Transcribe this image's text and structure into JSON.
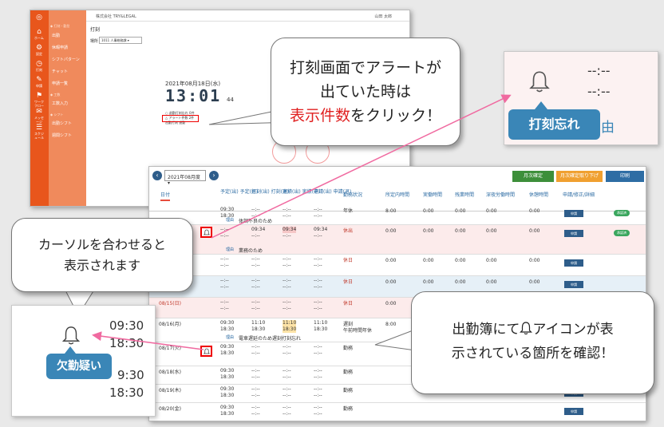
{
  "punch_screen": {
    "company": "株式会社 TRY&LEGAL",
    "user": "山田 太郎",
    "title": "打刻",
    "select_label": "場所",
    "select_value": "1011 人事総務課",
    "date": "2021年08月18日(水)",
    "time": "13:01",
    "seconds": "44",
    "alert_lines": [
      "○ 退勤打刻忘れ 0件",
      "△ アラート件数 2件",
      "出勤打刻  退勤"
    ],
    "nav_items": [
      "ホーム",
      "設定",
      "打刻",
      "申請",
      "ワークフロー",
      "メッセージ",
      "スケジュール"
    ],
    "nav_subs": [
      "出勤",
      "休暇申請",
      "シフトパターン",
      "チャット",
      "申請一覧",
      "工数入力",
      "出勤シフト",
      "週間シフト"
    ],
    "nav_sections": [
      "◆ 打刻・勤怠",
      "◆ 工数",
      "◆ シフト"
    ]
  },
  "attendance": {
    "month": "2021年08月度",
    "buttons": [
      {
        "label": "月次確定",
        "color": "#3d8f3a"
      },
      {
        "label": "月次確定取り下げ",
        "color": "#f0a030"
      },
      {
        "label": "印刷",
        "color": "#2e6da4"
      }
    ],
    "headers": [
      "日付",
      "予定(出)\n予定(退)",
      "打刻(出)\n打刻(退)",
      "実績(出)\n実績(退)",
      "申請(出)\n申請(退)",
      "勤務状況",
      "所定内時間",
      "実働時間",
      "残業時間",
      "深夜労働時間",
      "休憩時間",
      "申請/修正/詳細"
    ],
    "rows": [
      {
        "date": "",
        "plan_in": "09:30",
        "plan_out": "18:30",
        "punch_in": "--:--",
        "punch_out": "--:--",
        "act_in": "--:--",
        "act_out": "--:--",
        "req_in": "--:--",
        "req_out": "--:--",
        "status": "年休",
        "scheduled": "8:00",
        "work": "0:00",
        "overtime": "0:00",
        "night": "0:00",
        "break": "0:00",
        "reason": "体調不良のため",
        "approved": "承認済"
      },
      {
        "date": "",
        "plan_in": "--:--",
        "plan_out": "--:--",
        "punch_in": "09:34",
        "punch_out": "--:--",
        "act_in": "09:34",
        "act_out": "--:--",
        "req_in": "09:34",
        "req_out": "--:--",
        "status": "休出",
        "scheduled": "0:00",
        "work": "0:00",
        "overtime": "0:00",
        "night": "0:00",
        "break": "0:00",
        "reason": "業務のため",
        "approved": "承認済"
      },
      {
        "date": "",
        "plan_in": "--:--",
        "plan_out": "--:--",
        "punch_in": "--:--",
        "punch_out": "--:--",
        "act_in": "--:--",
        "act_out": "--:--",
        "req_in": "--:--",
        "req_out": "--:--",
        "status": "休日",
        "scheduled": "0:00",
        "work": "0:00",
        "overtime": "0:00",
        "night": "0:00",
        "break": "0:00"
      },
      {
        "date": "",
        "plan_in": "--:--",
        "plan_out": "--:--",
        "punch_in": "--:--",
        "punch_out": "--:--",
        "act_in": "--:--",
        "act_out": "--:--",
        "req_in": "--:--",
        "req_out": "--:--",
        "status": "休日",
        "scheduled": "0:00",
        "work": "0:00",
        "overtime": "0:00",
        "night": "0:00",
        "break": "0:00"
      },
      {
        "date": "08/15(日)",
        "plan_in": "--:--",
        "plan_out": "--:--",
        "punch_in": "--:--",
        "punch_out": "--:--",
        "act_in": "--:--",
        "act_out": "--:--",
        "req_in": "--:--",
        "req_out": "--:--",
        "status": "休日",
        "scheduled": "0:00",
        "work": "0:00",
        "overtime": "0:00",
        "night": "0:00",
        "break": "0:00"
      },
      {
        "date": "08/16(月)",
        "plan_in": "09:30",
        "plan_out": "18:30",
        "punch_in": "11:10",
        "punch_out": "18:30",
        "act_in": "11:10",
        "act_out": "18:30",
        "req_in": "11:10",
        "req_out": "18:30",
        "status": "遅刻\n午前時間年休",
        "scheduled": "8:00",
        "reason": "電車遅延のため遅刻打刻忘れ"
      },
      {
        "date": "08/17(火)",
        "plan_in": "09:30",
        "plan_out": "18:30",
        "punch_in": "--:--",
        "punch_out": "--:--",
        "act_in": "--:--",
        "act_out": "--:--",
        "req_in": "--:--",
        "req_out": "--:--",
        "status": "勤務"
      },
      {
        "date": "08/18(水)",
        "plan_in": "09:30",
        "plan_out": "18:30",
        "punch_in": "--:--",
        "punch_out": "--:--",
        "act_in": "--:--",
        "act_out": "--:--",
        "req_in": "--:--",
        "req_out": "--:--",
        "status": "勤務"
      },
      {
        "date": "08/19(木)",
        "plan_in": "09:30",
        "plan_out": "18:30",
        "punch_in": "--:--",
        "punch_out": "--:--",
        "act_in": "--:--",
        "act_out": "--:--",
        "req_in": "--:--",
        "req_out": "--:--",
        "status": "勤務"
      },
      {
        "date": "08/20(金)",
        "plan_in": "09:30",
        "plan_out": "18:30",
        "punch_in": "--:--",
        "punch_out": "--:--",
        "act_in": "--:--",
        "act_out": "--:--",
        "req_in": "--:--",
        "req_out": "--:--",
        "status": "勤務"
      }
    ],
    "reason_label": "理由",
    "apply_label": "申請"
  },
  "callouts": {
    "alert_click": {
      "line1": "打刻画面でアラートが",
      "line2": "出ていた時は",
      "highlight": "表示件数",
      "line3_rest": "をクリック！"
    },
    "hover": {
      "line1": "カーソルを合わせると",
      "line2": "表示されます"
    },
    "check": {
      "line1_a": "出勤簿にて",
      "line1_b": "アイコンが表",
      "line2": "示されている箇所を確認！"
    }
  },
  "zoom_punch": {
    "time1": "--:--",
    "time2": "--:--",
    "tooltip": "打刻忘れ",
    "partial": "由"
  },
  "zoom_absent": {
    "time1": "09:30",
    "time2": "18:30",
    "time3": "9:30",
    "time4": "18:30",
    "tooltip": "欠勤疑い"
  },
  "colors": {
    "accent": "#e8561c",
    "tooltip": "#3a86b7",
    "alert_red": "#e02020",
    "arrow": "#f06aa0"
  }
}
